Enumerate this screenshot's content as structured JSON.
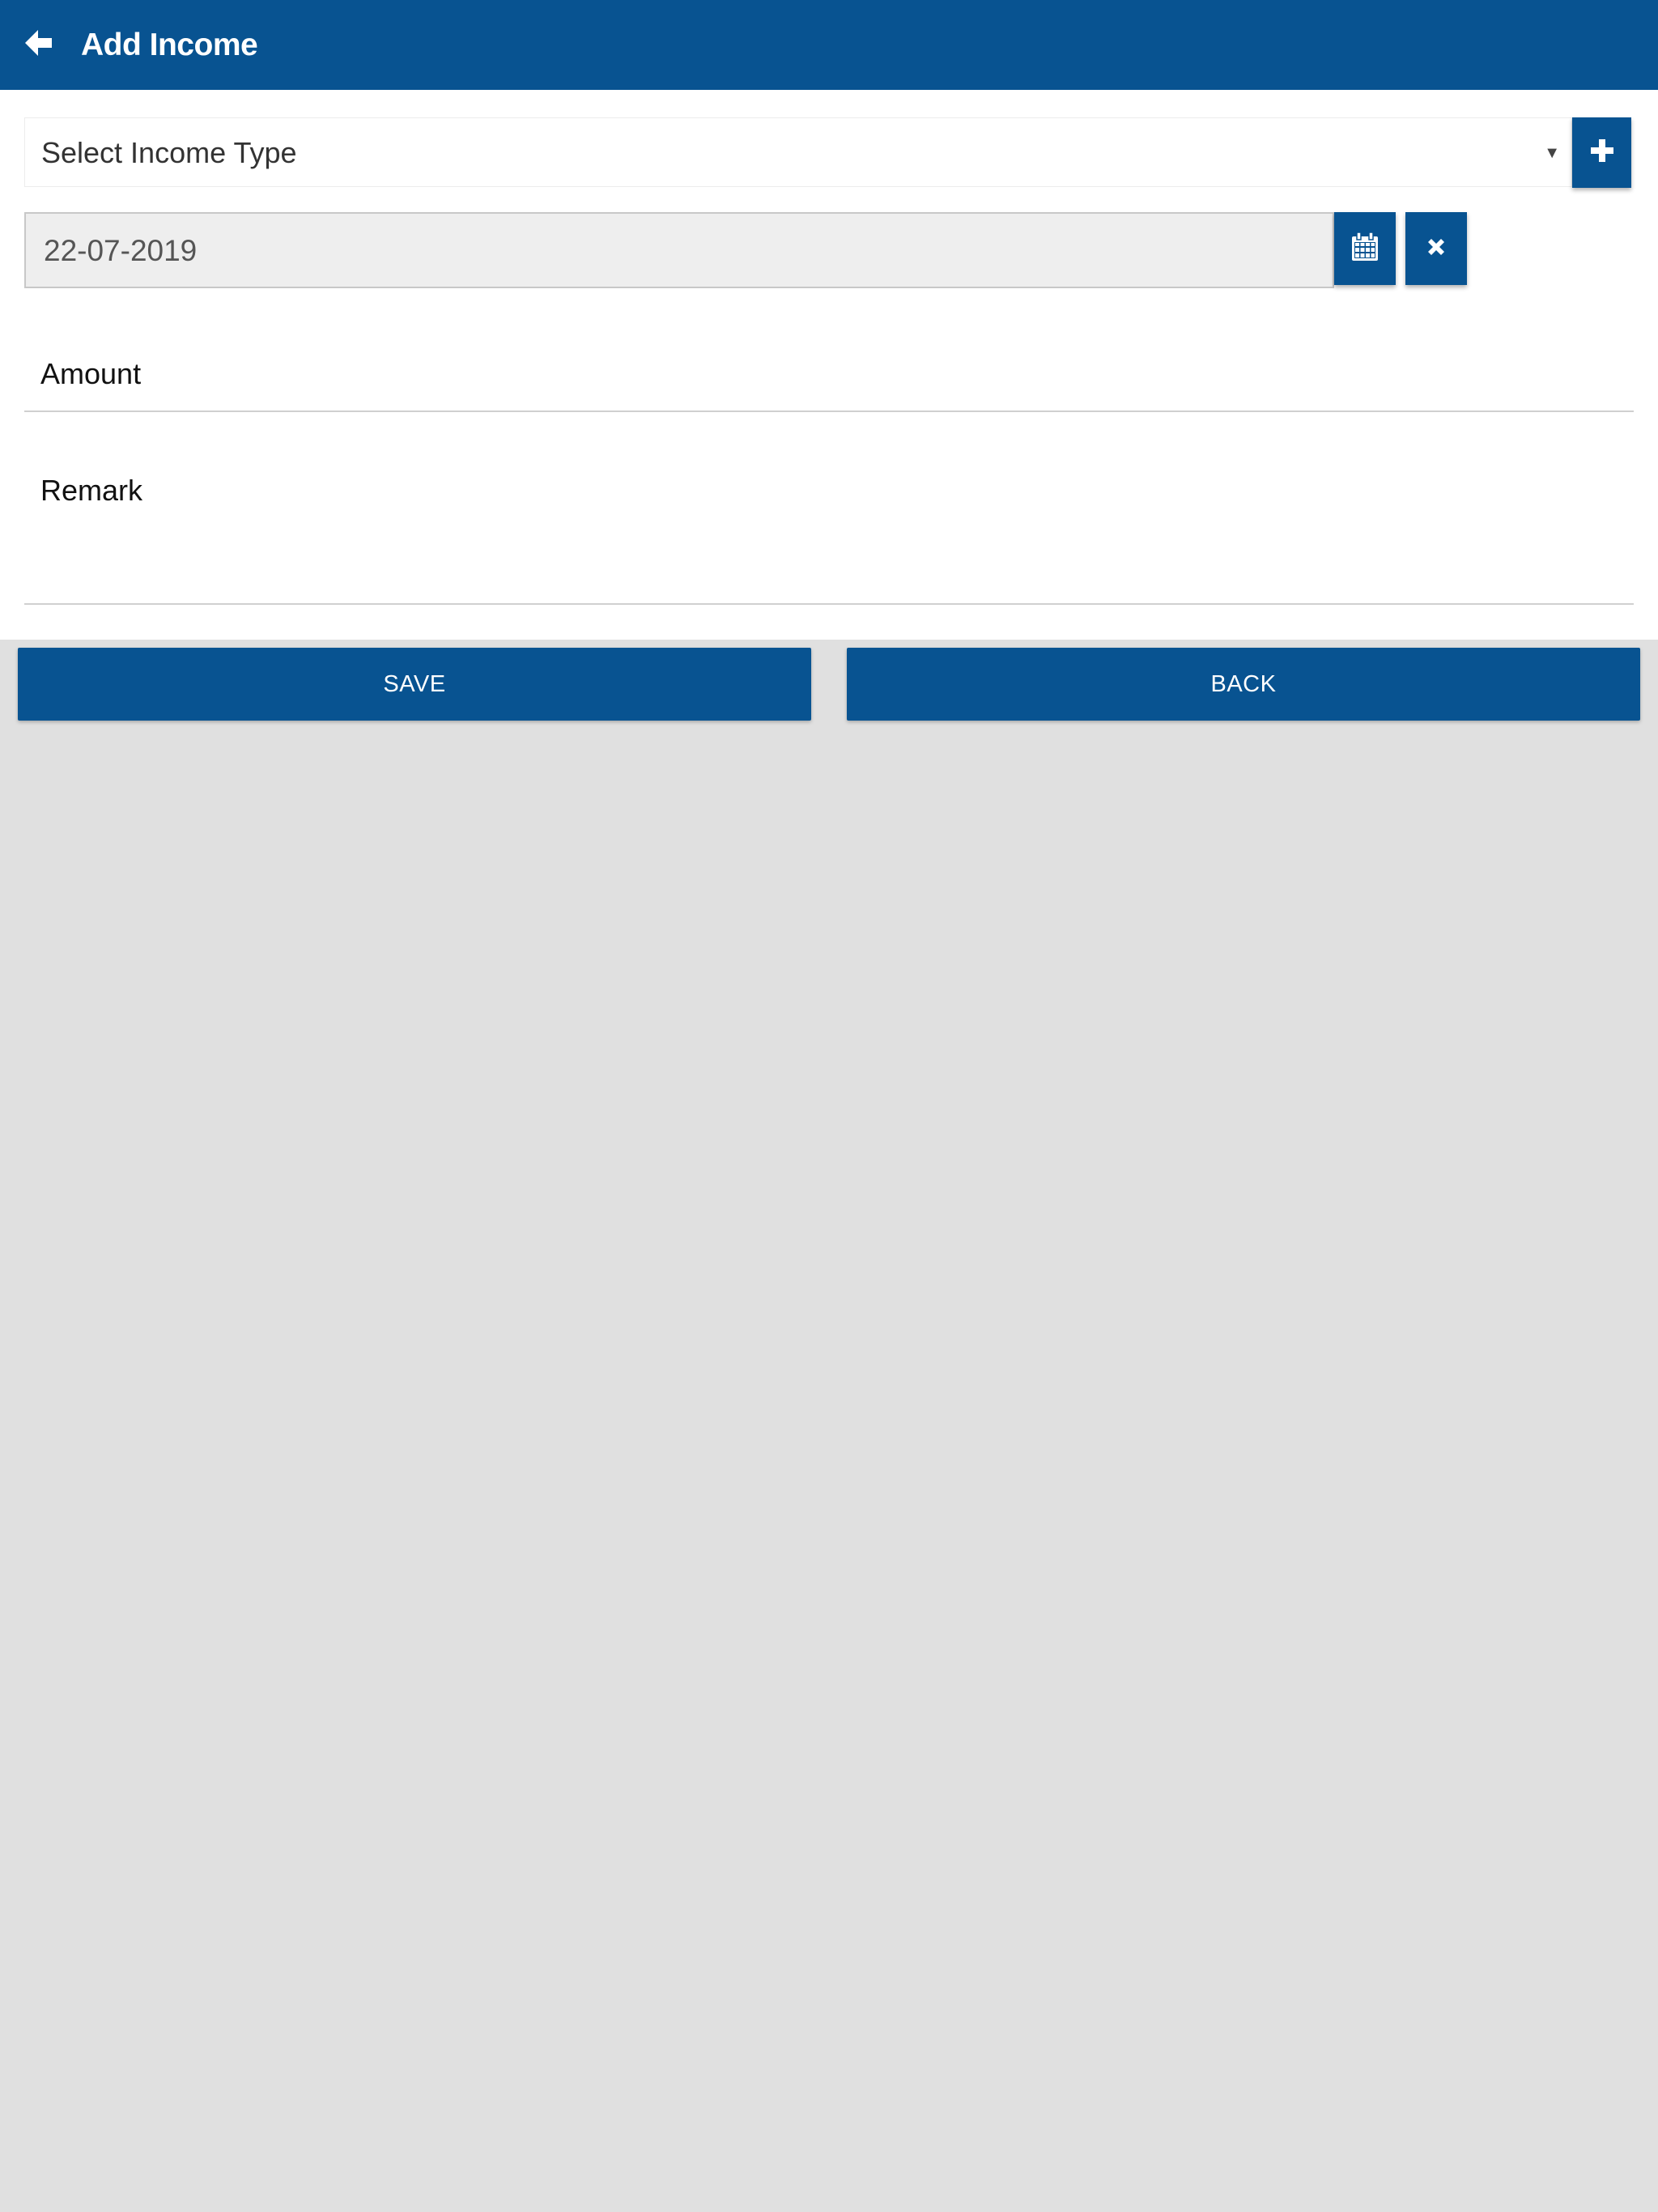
{
  "header": {
    "title": "Add Income",
    "back_icon": "arrow-left-icon",
    "color": "#085391"
  },
  "form": {
    "income_type": {
      "selected": "Select Income Type",
      "caret": "▼",
      "add_icon": "plus-icon"
    },
    "date": {
      "value": "22-07-2019",
      "calendar_icon": "calendar-icon",
      "clear_icon": "close-icon"
    },
    "amount": {
      "placeholder": "Amount"
    },
    "remark": {
      "placeholder": "Remark"
    }
  },
  "actions": {
    "save_label": "SAVE",
    "back_label": "BACK"
  },
  "colors": {
    "primary": "#085391",
    "background": "#e0e0e0",
    "panel": "#ffffff"
  }
}
